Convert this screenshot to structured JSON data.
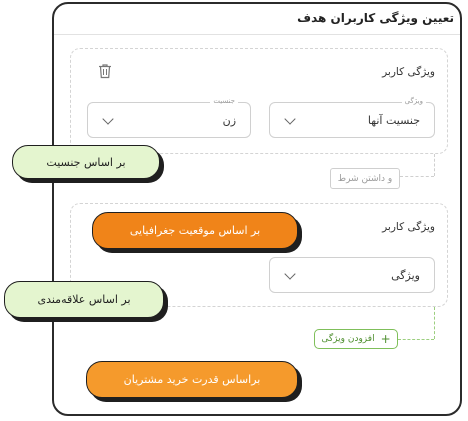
{
  "panel": {
    "title": "تعیین ویژگی کاربران هدف"
  },
  "card1": {
    "title": "ویژگی کاربر",
    "trash_icon": "trash-icon",
    "property_select": {
      "label": "ویژگی",
      "value": "جنسیت آنها"
    },
    "gender_select": {
      "label": "جنسیت",
      "value": "زن"
    }
  },
  "condition_chip": "و داشتن شرط",
  "card2": {
    "title": "ویژگی کاربر",
    "property_select": {
      "value": "ویژگی"
    }
  },
  "add_property": {
    "label": "افزودن ویژگی",
    "icon": "plus-icon"
  },
  "callouts": {
    "gender": "بر اساس جنسیت",
    "location": "بر اساس موقعیت جغرافیایی",
    "interest": "بر اساس علاقه‌مندی",
    "purchase_power": "براساس قدرت خرید مشتریان"
  },
  "colors": {
    "green_fill": "#e4f5cf",
    "orange_fill": "#f59a2c",
    "dashed_green": "#9ccf7f"
  }
}
